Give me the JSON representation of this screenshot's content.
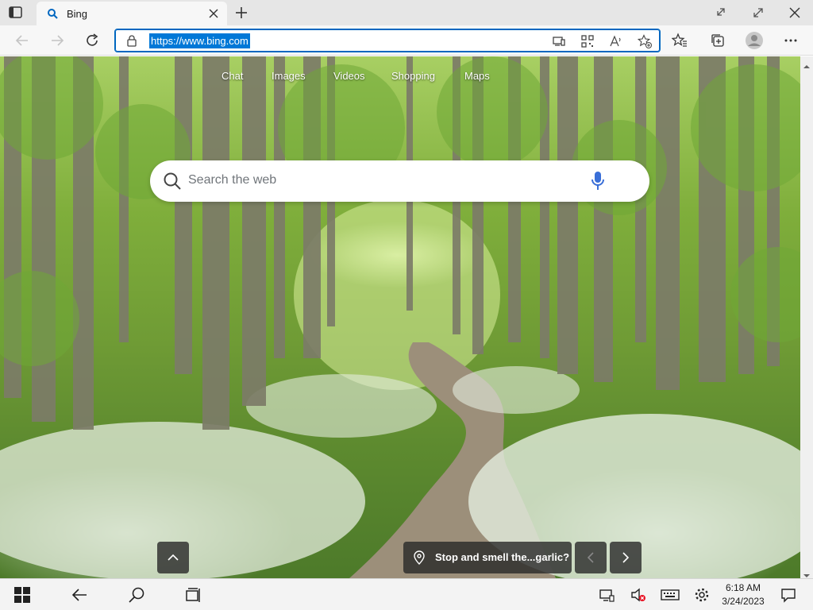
{
  "browser": {
    "tab": {
      "title": "Bing"
    },
    "address_bar": {
      "url": "https://www.bing.com"
    }
  },
  "page": {
    "nav_links": [
      "Chat",
      "Images",
      "Videos",
      "Shopping",
      "Maps"
    ],
    "search": {
      "placeholder": "Search the web"
    },
    "image_caption": "Stop and smell the...garlic?"
  },
  "taskbar": {
    "time": "6:18 AM",
    "date": "3/24/2023"
  },
  "colors": {
    "accent": "#0067c0",
    "url_highlight": "#0078d7",
    "mic": "#3a6fd8",
    "overlay_buttons": "#282828"
  }
}
